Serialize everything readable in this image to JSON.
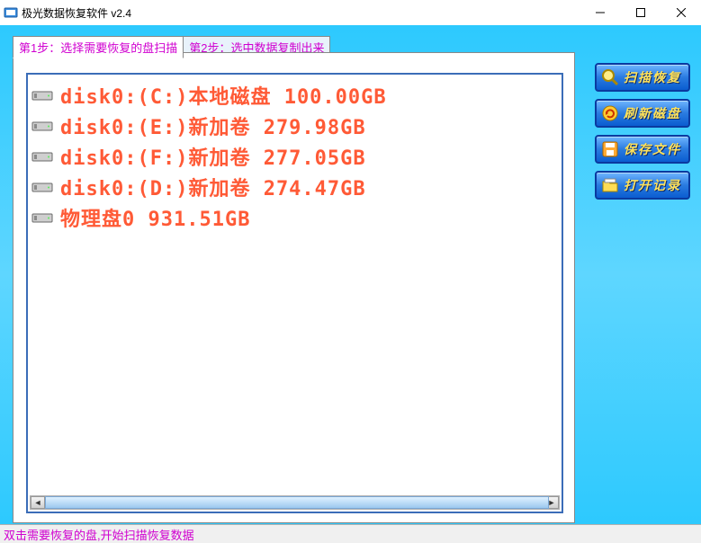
{
  "window": {
    "title": "极光数据恢复软件 v2.4"
  },
  "tabs": {
    "step1": "第1步：选择需要恢复的盘扫描",
    "step2": "第2步：选中数据复制出来"
  },
  "disks": [
    {
      "label": "disk0:(C:)本地磁盘 100.00GB"
    },
    {
      "label": "disk0:(E:)新加卷 279.98GB"
    },
    {
      "label": "disk0:(F:)新加卷 277.05GB"
    },
    {
      "label": "disk0:(D:)新加卷 274.47GB"
    },
    {
      "label": "物理盘0 931.51GB"
    }
  ],
  "buttons": {
    "scan": "扫描恢复",
    "refresh": "刷新磁盘",
    "save": "保存文件",
    "open": "打开记录"
  },
  "status": "双击需要恢复的盘,开始扫描恢复数据"
}
